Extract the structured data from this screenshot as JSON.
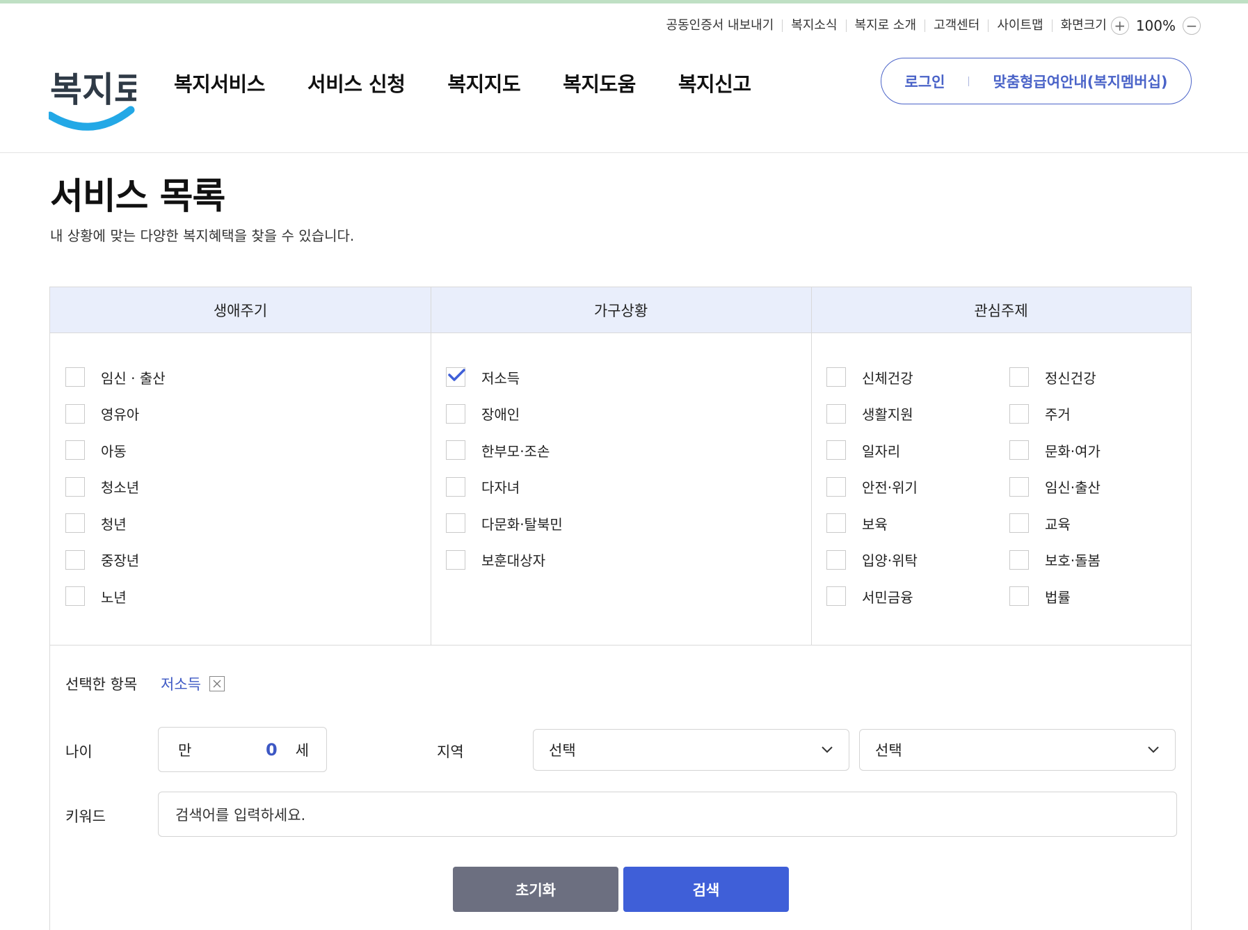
{
  "utility": {
    "items": [
      "공동인증서 내보내기",
      "복지소식",
      "복지로 소개",
      "고객센터",
      "사이트맵"
    ],
    "font_size_label": "화면크기",
    "zoom_in": "+",
    "zoom_level": "100%",
    "zoom_out": "−"
  },
  "logo": {
    "text": "복지로"
  },
  "gnb": [
    "복지서비스",
    "서비스 신청",
    "복지지도",
    "복지도움",
    "복지신고"
  ],
  "auth": {
    "login": "로그인",
    "membership": "맞춤형급여안내(복지멤버십)"
  },
  "page": {
    "title": "서비스 목록",
    "description": "내 상황에 맞는 다양한 복지혜택을 찾을 수 있습니다."
  },
  "filters": {
    "lifecycle": {
      "header": "생애주기",
      "items": [
        "임신 · 출산",
        "영유아",
        "아동",
        "청소년",
        "청년",
        "중장년",
        "노년"
      ]
    },
    "household": {
      "header": "가구상황",
      "items": [
        "저소득",
        "장애인",
        "한부모·조손",
        "다자녀",
        "다문화·탈북민",
        "보훈대상자"
      ],
      "checked": [
        "저소득"
      ]
    },
    "interest": {
      "header": "관심주제",
      "col1": [
        "신체건강",
        "생활지원",
        "일자리",
        "안전·위기",
        "보육",
        "입양·위탁",
        "서민금융"
      ],
      "col2": [
        "정신건강",
        "주거",
        "문화·여가",
        "임신·출산",
        "교육",
        "보호·돌봄",
        "법률"
      ]
    }
  },
  "selected": {
    "label": "선택한 항목",
    "chips": [
      "저소득"
    ]
  },
  "age": {
    "label": "나이",
    "prefix": "만",
    "value": "0",
    "suffix": "세"
  },
  "region": {
    "label": "지역",
    "select1": "선택",
    "select2": "선택"
  },
  "keyword": {
    "label": "키워드",
    "placeholder": "검색어를 입력하세요."
  },
  "buttons": {
    "reset": "초기화",
    "search": "검색"
  },
  "colors": {
    "accent": "#3f5fd8",
    "header_bg": "#e9eefb",
    "reset_bg": "#6c6f80",
    "logo_blue": "#23a8e6"
  }
}
